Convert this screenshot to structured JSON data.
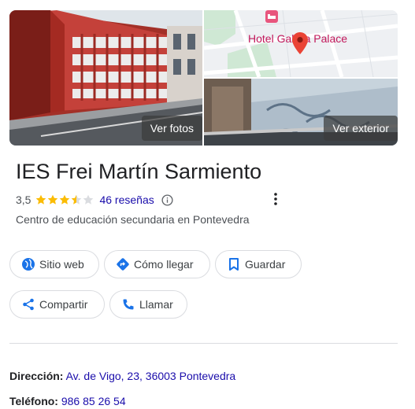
{
  "place": {
    "name": "IES Frei Martín Sarmiento",
    "rating": "3,5",
    "rating_value": 3.5,
    "stars_max": 5,
    "reviews": "46 reseñas",
    "category": "Centro de educación secundaria en Pontevedra"
  },
  "photos": {
    "see_photos_label": "Ver fotos",
    "see_exterior_label": "Ver exterior",
    "map_label": "Hotel Galicia Palace"
  },
  "actions": {
    "website": "Sitio web",
    "directions": "Cómo llegar",
    "save": "Guardar",
    "share": "Compartir",
    "call": "Llamar"
  },
  "details": {
    "address_label": "Dirección:",
    "address_value": "Av. de Vigo, 23, 36003 Pontevedra",
    "phone_label": "Teléfono:",
    "phone_value": "986 85 26 54"
  },
  "colors": {
    "accent_blue": "#1a73e8",
    "link_blue": "#1a0dab",
    "star_yellow": "#fbbc04",
    "pin_red": "#ea4335"
  }
}
